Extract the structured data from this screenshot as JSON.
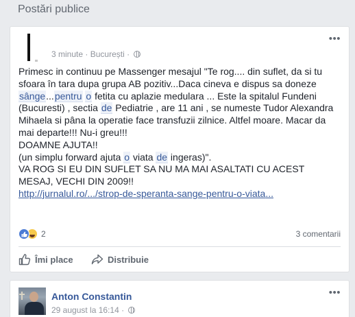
{
  "section": {
    "title": "Postări publice"
  },
  "post1": {
    "time": "3 minute",
    "separator": "·",
    "location": "București",
    "separator2": "·",
    "privacy_icon": "globe-icon",
    "more_label": "•••",
    "text": {
      "l1": "Primesc in continuu pe Massenger mesajul \"Te rog.... din suflet, da si tu",
      "l2": "sfoara în tara dupa grupa AB pozitiv...Daca cineva e dispus sa doneze",
      "l3_kw1": "sânge",
      "l3_a": "...",
      "l3_kw2": "pentru",
      "l3_b": " ",
      "l3_kw3": "o",
      "l3_c": " fetita cu aplazie medulara ... Este la spitalul Fundeni",
      "l4_a": "(Bucuresti) , sectia ",
      "l4_kw": "de",
      "l4_b": " Pediatrie , are 11 ani , se numeste Tudor Alexandra",
      "l5": "Mihaela si pâna la operatie face transfuzii zilnice. Altfel moare. Macar da",
      "l6": "mai departe!!! Nu-i greu!!!",
      "l7": "DOAMNE AJUTA!!",
      "l8_a": "(un simplu forward ajuta ",
      "l8_kw1": "o",
      "l8_b": " viata ",
      "l8_kw2": "de",
      "l8_c": " ingeras)\".",
      "l9": "VA ROG SI EU DIN SUFLET SA NU MA MAI ASALTATI CU ACEST",
      "l10": "MESAJ, VECHI DIN 2009!!"
    },
    "link": {
      "part1": "http://jurnalul.ro/",
      "part2": ".../",
      "part3": "strop-de-speranta-sange-pentru-o-viata",
      "part4": "..."
    },
    "reactions": {
      "like_icon": "like-reaction-icon",
      "haha_icon": "haha-reaction-icon",
      "count": "2"
    },
    "comments": "3 comentarii",
    "actions": {
      "like": "Îmi place",
      "share": "Distribuie"
    }
  },
  "post2": {
    "author": "Anton Constantin",
    "date": "29 august la 16:14",
    "separator": "·",
    "privacy_icon": "globe-icon",
    "more_label": "•••"
  }
}
